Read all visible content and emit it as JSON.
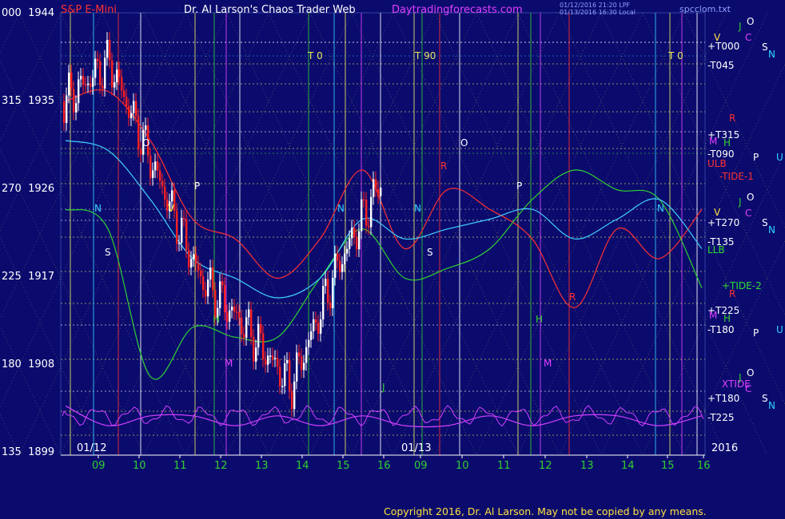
{
  "header": {
    "left": "S&P E-Mini",
    "title": "Dr. Al Larson's Chaos Trader Web",
    "site": "Daytradingforecasts.com",
    "file": "spcclom.txt",
    "stamp_line1": "01/12/2016 21:20 LPF",
    "stamp_line2": "01/13/2016 16:30 Local"
  },
  "y_axis": [
    {
      "code": "000",
      "price": "1944"
    },
    {
      "code": "315",
      "price": "1935"
    },
    {
      "code": "270",
      "price": "1926"
    },
    {
      "code": "225",
      "price": "1917"
    },
    {
      "code": "180",
      "price": "1908"
    },
    {
      "code": "135",
      "price": "1899"
    }
  ],
  "x_axis": [
    "09",
    "10",
    "11",
    "12",
    "13",
    "14",
    "15",
    "16",
    "09",
    "10",
    "11",
    "12",
    "13",
    "14",
    "15",
    "16"
  ],
  "date_tags": [
    "01/12",
    "01/13"
  ],
  "year": "2016",
  "right_labels": [
    {
      "text": "+T000",
      "color": "#ffffff"
    },
    {
      "text": "-T045",
      "color": "#ffffff"
    },
    {
      "text": "+T315",
      "color": "#ffffff"
    },
    {
      "text": "-T090",
      "color": "#ffffff"
    },
    {
      "text": "ULB",
      "color": "#ff3030"
    },
    {
      "text": "-TIDE-1",
      "color": "#ff3030"
    },
    {
      "text": "+T270",
      "color": "#ffffff"
    },
    {
      "text": "-T135",
      "color": "#ffffff"
    },
    {
      "text": "LLB",
      "color": "#30e030"
    },
    {
      "text": "+TIDE-2",
      "color": "#30e030"
    },
    {
      "text": "+T225",
      "color": "#ffffff"
    },
    {
      "text": "-T180",
      "color": "#ffffff"
    },
    {
      "text": "XTIDE",
      "color": "#e040ff"
    },
    {
      "text": "+T180",
      "color": "#ffffff"
    },
    {
      "text": "-T225",
      "color": "#ffffff"
    }
  ],
  "planet_labels": [
    {
      "text": "J",
      "color": "#30d030"
    },
    {
      "text": "O",
      "color": "#ffffff"
    },
    {
      "text": "C",
      "color": "#e040ff"
    },
    {
      "text": "S",
      "color": "#ffffff"
    },
    {
      "text": "N",
      "color": "#30d0ff"
    },
    {
      "text": "V",
      "color": "#ffe040"
    },
    {
      "text": "M",
      "color": "#e040ff"
    },
    {
      "text": "H",
      "color": "#30d030"
    },
    {
      "text": "P",
      "color": "#ffffff"
    },
    {
      "text": "U",
      "color": "#30d0ff"
    },
    {
      "text": "R",
      "color": "#ff3030"
    }
  ],
  "grid_letters": [
    "T 0",
    "T 90",
    "T 0",
    "O",
    "P",
    "N",
    "S",
    "R",
    "V",
    "H",
    "M",
    "J"
  ],
  "copyright": "Copyright 2016, Dr. Al Larson. May not be copied by any means.",
  "colors": {
    "background": "#0b0b6e",
    "grid_yellow": "#e8e860",
    "price_up": "#ffffff",
    "price_down": "#ff2020",
    "ulb_red": "#ff3030",
    "llb_green": "#30d030",
    "tide_cyan": "#40d0ff",
    "xtide_magenta": "#d040ff"
  },
  "chart_data": {
    "type": "line",
    "title": "S&P E-Mini",
    "x": [
      "09",
      "10",
      "11",
      "12",
      "13",
      "14",
      "15",
      "16",
      "09",
      "10",
      "11",
      "12",
      "13",
      "14",
      "15",
      "16"
    ],
    "ylim": [
      1899,
      1944
    ],
    "series": [
      {
        "name": "",
        "values": [
          1935,
          1939,
          1928,
          1917,
          1912,
          1906,
          1918,
          1927
        ]
      },
      {
        "name": "ULB",
        "values": [
          1935,
          1936,
          1931,
          1923,
          1921,
          1917,
          1921,
          1928,
          1920,
          1926,
          1924,
          1921,
          1914,
          1922,
          1919,
          1924
        ]
      },
      {
        "name": "LLB",
        "values": [
          1924,
          1922,
          1907,
          1912,
          1911,
          1911,
          1917,
          1922,
          1917,
          1918,
          1920,
          1925,
          1928,
          1926,
          1925,
          1916
        ]
      },
      {
        "name": "TIDE-1",
        "values": [
          1931,
          1930,
          1925,
          1919,
          1917,
          1915,
          1917,
          1923,
          1921,
          1922,
          1923,
          1924,
          1921,
          1923,
          1925,
          1920
        ]
      },
      {
        "name": "XTIDE",
        "values": [
          1904,
          1902,
          1903,
          1903,
          1902,
          1903,
          1902,
          1903,
          1902,
          1902,
          1903,
          1902,
          1903,
          1903,
          1902,
          1903
        ]
      }
    ]
  }
}
